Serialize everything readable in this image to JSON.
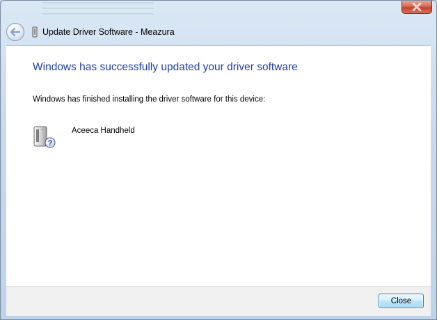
{
  "window": {
    "title": "Update Driver Software - Meazura"
  },
  "content": {
    "heading": "Windows has successfully updated your driver software",
    "message": "Windows has finished installing the driver software for this device:",
    "device_name": "Aceeca Handheld"
  },
  "footer": {
    "close_label": "Close"
  },
  "icons": {
    "back": "back-arrow-icon",
    "title": "usb-device-icon",
    "device": "device-unknown-icon",
    "window_close": "close-icon"
  },
  "colors": {
    "heading": "#1e3fa8",
    "close_button_red": "#c2432e"
  }
}
